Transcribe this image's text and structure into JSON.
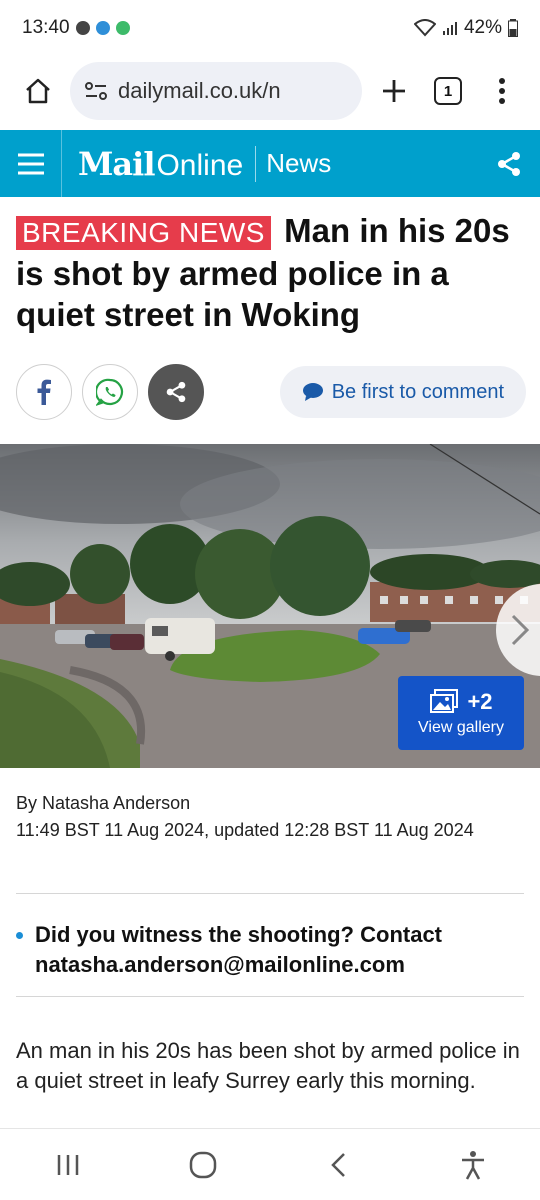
{
  "status_bar": {
    "time": "13:40",
    "battery": "42%"
  },
  "browser": {
    "url": "dailymail.co.uk/n",
    "tab_count": "1"
  },
  "site": {
    "logo_mail": "Mail",
    "logo_online": "Online",
    "section": "News"
  },
  "article": {
    "breaking_label": "BREAKING NEWS",
    "headline": "Man in his 20s is shot by armed police in a quiet street in Woking",
    "comment_label": "Be first to comment",
    "gallery": {
      "count": "+2",
      "label": "View gallery"
    },
    "author": "By Natasha Anderson",
    "timestamp": "11:49 BST 11 Aug 2024, updated 12:28 BST 11 Aug 2024",
    "witness_line1": "Did you witness the shooting? Contact",
    "witness_line2": "natasha.anderson@mailonline.com",
    "body": "An man in his 20s has been shot by armed police in a quiet street in leafy Surrey early this morning."
  },
  "colors": {
    "brand": "#00a0cc",
    "breaking": "#e63c4b",
    "gallery": "#1454c8",
    "link": "#1a5aa8"
  },
  "icons": [
    "home-icon",
    "site-settings-icon",
    "plus-icon",
    "tabs-icon",
    "more-vert-icon",
    "hamburger-icon",
    "share-icon",
    "facebook-icon",
    "whatsapp-icon",
    "comment-icon",
    "gallery-icon",
    "chevron-right-icon",
    "recents-icon",
    "home-circle-icon",
    "back-icon",
    "accessibility-icon"
  ]
}
